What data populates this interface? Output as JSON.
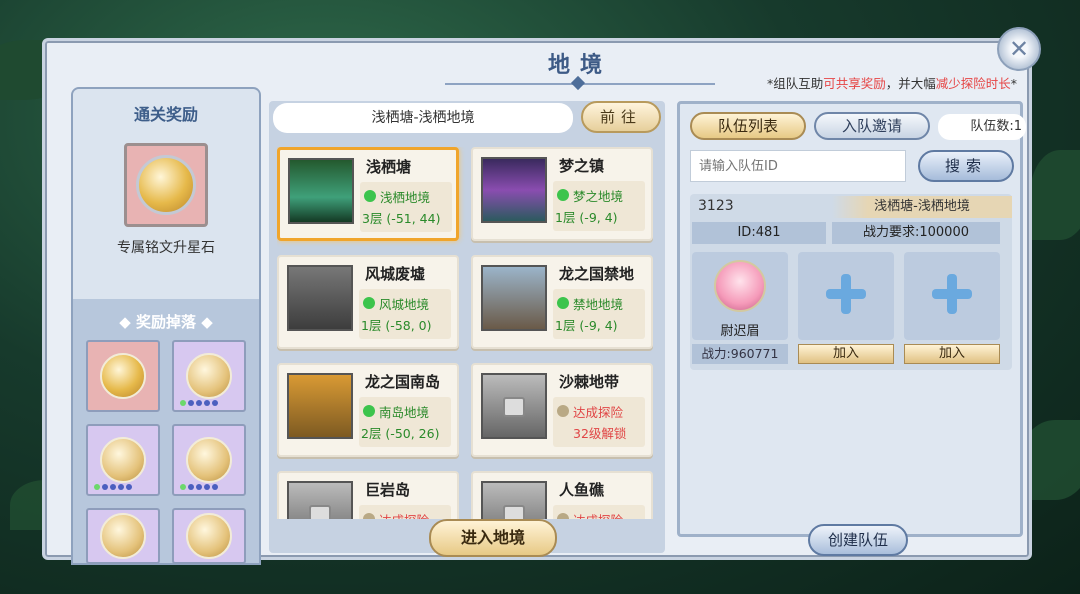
{
  "header": {
    "title": "地境",
    "notice_prefix": "*组队互助",
    "notice_red1": "可共享奖励",
    "notice_mid": "，并大幅",
    "notice_red2": "减少探险时长",
    "notice_suffix": "*"
  },
  "rewards": {
    "title": "通关奖励",
    "main_item_name": "专属铭文升星石",
    "drop_title": "◆ 奖励掉落 ◆",
    "drops": [
      {
        "bg": "#e8b3b3",
        "dots": 0
      },
      {
        "bg": "#d7c8f0",
        "dots": 5
      },
      {
        "bg": "#d7c8f0",
        "dots": 5
      },
      {
        "bg": "#d7c8f0",
        "dots": 5
      },
      {
        "bg": "#d7c8f0",
        "dots": 0
      },
      {
        "bg": "#d7c8f0",
        "dots": 0
      }
    ]
  },
  "map": {
    "current_location": "浅栖塘-浅栖地境",
    "goto_label": "前往",
    "enter_label": "进入地境",
    "cards": [
      {
        "name": "浅栖塘",
        "realm": "浅栖地境",
        "floor": "3层 (-51, 44)"
      },
      {
        "name": "梦之镇",
        "realm": "梦之地境",
        "floor": "1层 (-9, 4)"
      },
      {
        "name": "风城废墟",
        "realm": "风城地境",
        "floor": "1层 (-58, 0)"
      },
      {
        "name": "龙之国禁地",
        "realm": "禁地地境",
        "floor": "1层 (-9, 4)"
      },
      {
        "name": "龙之国南岛",
        "realm": "南岛地境",
        "floor": "2层 (-50, 26)"
      },
      {
        "name": "沙棘地带",
        "realm": "达成探险",
        "floor": "32级解锁"
      },
      {
        "name": "巨岩岛",
        "realm": "达成探险",
        "floor": ""
      },
      {
        "name": "人鱼礁",
        "realm": "达成探险",
        "floor": ""
      }
    ]
  },
  "team": {
    "tab_list": "队伍列表",
    "tab_invite": "入队邀请",
    "count_label": "队伍数:1",
    "id_placeholder": "请输入队伍ID",
    "search_label": "搜索",
    "card": {
      "number": "3123",
      "location": "浅栖塘-浅栖地境",
      "id_label": "ID:481",
      "power_req": "战力要求:100000",
      "member_name": "尉迟眉",
      "member_power": "战力:960771",
      "join_label": "加入"
    },
    "create_label": "创建队伍"
  },
  "icons": {
    "close": "close-icon",
    "lock": "lock-icon",
    "plus": "plus-icon"
  }
}
